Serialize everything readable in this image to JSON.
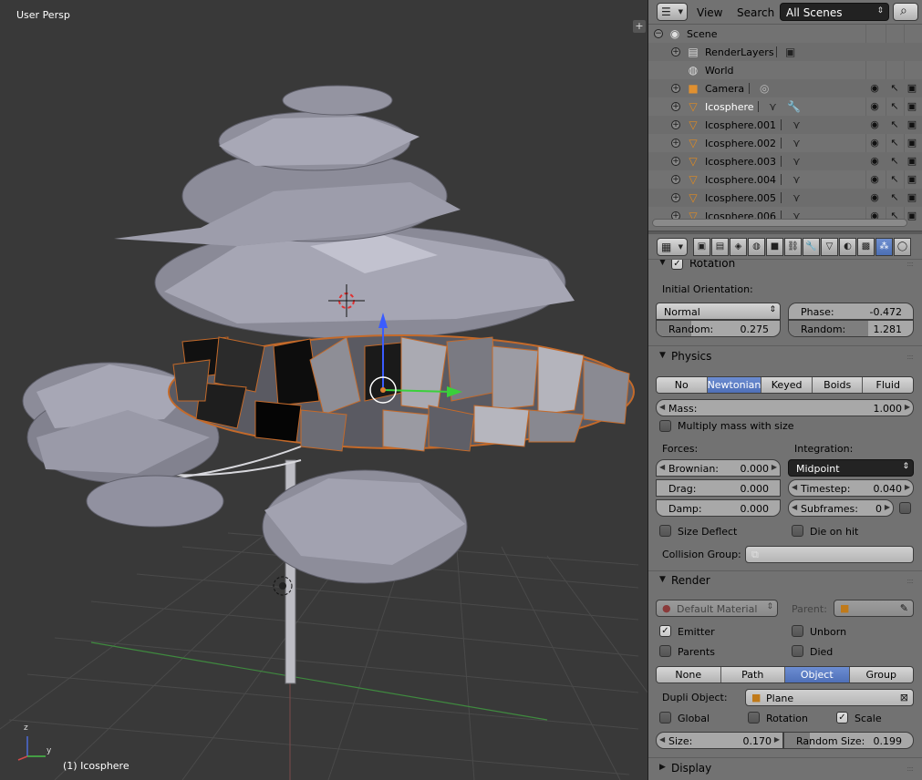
{
  "viewport": {
    "title": "User Persp",
    "active_object": "(1) Icosphere",
    "axis_x": "x",
    "axis_y": "y",
    "axis_z": "z",
    "plus_icon": "plus-icon"
  },
  "outliner": {
    "menu_view": "View",
    "menu_search": "Search",
    "scenes_select": "All Scenes",
    "rows": [
      {
        "label": "Scene",
        "icon": "scene-icon",
        "expand": "−"
      },
      {
        "label": "RenderLayers",
        "icon": "renderlayers-icon",
        "expand": "+"
      },
      {
        "label": "World",
        "icon": "world-icon",
        "expand": ""
      },
      {
        "label": "Camera",
        "icon": "camera-icon",
        "expand": "+"
      },
      {
        "label": "Icosphere",
        "icon": "mesh-object-icon",
        "expand": "+"
      },
      {
        "label": "Icosphere.001",
        "icon": "mesh-object-icon",
        "expand": "+"
      },
      {
        "label": "Icosphere.002",
        "icon": "mesh-object-icon",
        "expand": "+"
      },
      {
        "label": "Icosphere.003",
        "icon": "mesh-object-icon",
        "expand": "+"
      },
      {
        "label": "Icosphere.004",
        "icon": "mesh-object-icon",
        "expand": "+"
      },
      {
        "label": "Icosphere.005",
        "icon": "mesh-object-icon",
        "expand": "+"
      },
      {
        "label": "Icosphere.006",
        "icon": "mesh-object-icon",
        "expand": "+"
      }
    ]
  },
  "properties": {
    "rotation": {
      "title": "Rotation",
      "initial_orientation_label": "Initial Orientation:",
      "orientation": "Normal",
      "random_label": "Random:",
      "random_value": "0.275",
      "phase_label": "Phase:",
      "phase_value": "-0.472",
      "phase_random_label": "Random:",
      "phase_random_value": "1.281"
    },
    "physics": {
      "title": "Physics",
      "types": [
        "No",
        "Newtonian",
        "Keyed",
        "Boids",
        "Fluid"
      ],
      "active_type": "Newtonian",
      "mass_label": "Mass:",
      "mass_value": "1.000",
      "multiply_mass": "Multiply mass with size",
      "forces_label": "Forces:",
      "integration_label": "Integration:",
      "brownian_label": "Brownian:",
      "brownian_value": "0.000",
      "drag_label": "Drag:",
      "drag_value": "0.000",
      "damp_label": "Damp:",
      "damp_value": "0.000",
      "integration": "Midpoint",
      "timestep_label": "Timestep:",
      "timestep_value": "0.040",
      "subframes_label": "Subframes:",
      "subframes_value": "0",
      "size_deflect": "Size Deflect",
      "die_on_hit": "Die on hit",
      "collision_group_label": "Collision Group:"
    },
    "render": {
      "title": "Render",
      "material": "Default Material",
      "parent_label": "Parent:",
      "emitter": "Emitter",
      "unborn": "Unborn",
      "parents": "Parents",
      "died": "Died",
      "modes": [
        "None",
        "Path",
        "Object",
        "Group"
      ],
      "active_mode": "Object",
      "dupli_object_label": "Dupli Object:",
      "dupli_object": "Plane",
      "global": "Global",
      "rotation": "Rotation",
      "scale": "Scale",
      "size_label": "Size:",
      "size_value": "0.170",
      "random_size_label": "Random Size:",
      "random_size_value": "0.199"
    },
    "display": {
      "title": "Display"
    }
  },
  "colors": {
    "viewport_bg": "#393939",
    "panel_bg": "#727272",
    "active_blue": "#5680c2",
    "selection_orange": "#e08030"
  }
}
